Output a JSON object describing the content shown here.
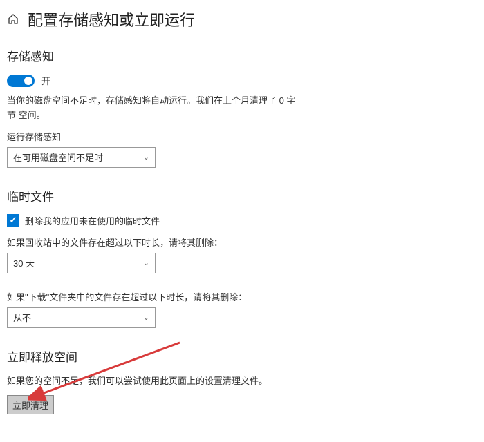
{
  "header": {
    "title": "配置存储感知或立即运行"
  },
  "storage_sense": {
    "section_title": "存储感知",
    "toggle_label": "开",
    "desc": "当你的磁盘空间不足时，存储感知将自动运行。我们在上个月清理了 0 字节 空间。",
    "run_label": "运行存储感知",
    "run_select": "在可用磁盘空间不足时"
  },
  "temp_files": {
    "section_title": "临时文件",
    "checkbox_label": "删除我的应用未在使用的临时文件",
    "recycle_desc": "如果回收站中的文件存在超过以下时长，请将其删除：",
    "recycle_select": "30 天",
    "downloads_desc": "如果\"下载\"文件夹中的文件存在超过以下时长，请将其删除：",
    "downloads_select": "从不"
  },
  "free_space": {
    "section_title": "立即释放空间",
    "desc": "如果您的空间不足，我们可以尝试使用此页面上的设置清理文件。",
    "button_label": "立即清理"
  }
}
